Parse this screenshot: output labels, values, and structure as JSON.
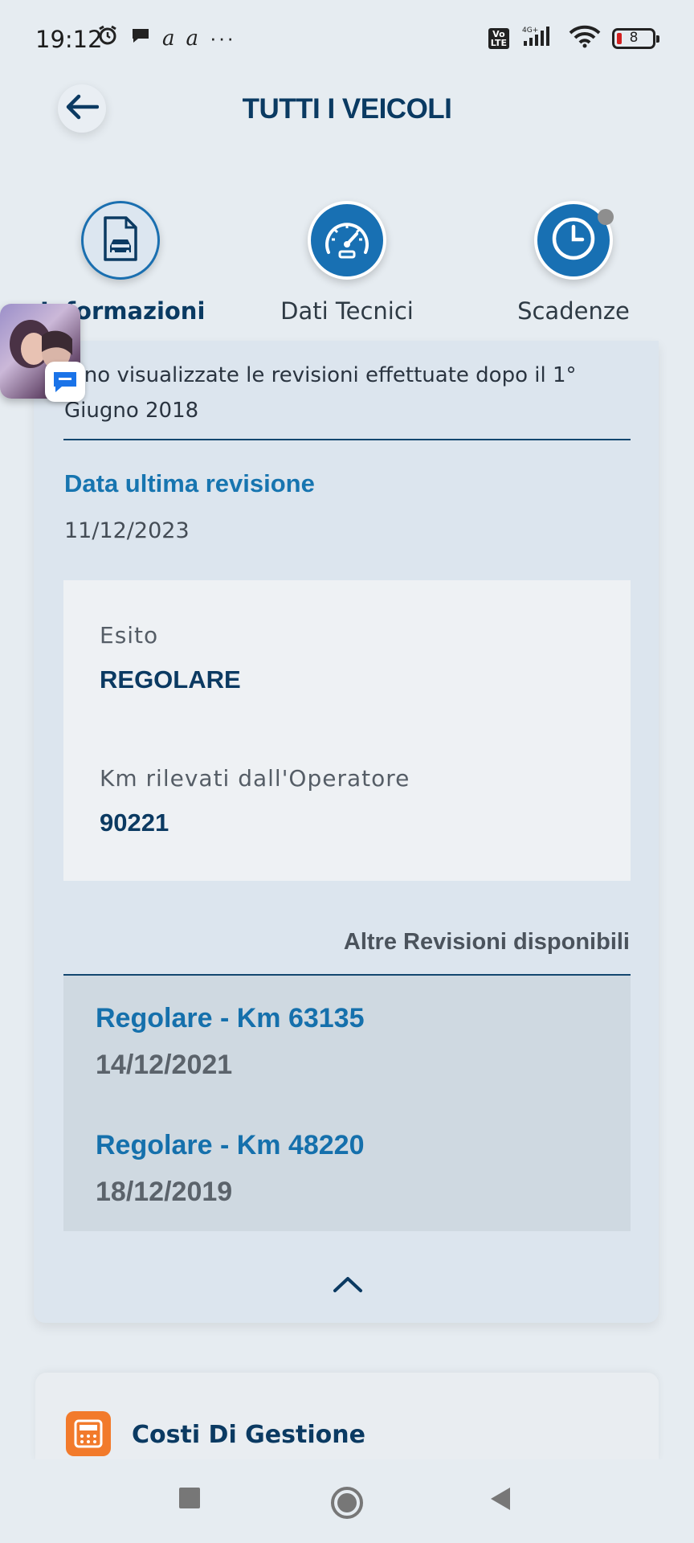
{
  "status_bar": {
    "time": "19:12",
    "battery": "8",
    "network": "4G+",
    "volte": "Vo LTE"
  },
  "header": {
    "title": "TUTTI I VEICOLI"
  },
  "tabs": [
    {
      "label": "Informazioni",
      "icon": "vehicle-document-icon",
      "active": true
    },
    {
      "label": "Dati Tecnici",
      "icon": "speedometer-icon",
      "active": false
    },
    {
      "label": "Scadenze",
      "icon": "clock-icon",
      "active": false
    }
  ],
  "revision": {
    "note": "...no visualizzate le revisioni effettuate dopo il 1° Giugno 2018",
    "last_title": "Data ultima revisione",
    "last_date": "11/12/2023",
    "esito_label": "Esito",
    "esito_value": "REGOLARE",
    "km_label": "Km rilevati dall'Operatore",
    "km_value": "90221",
    "others_label": "Altre Revisioni disponibili",
    "others": [
      {
        "title": "Regolare - Km 63135",
        "date": "14/12/2021"
      },
      {
        "title": "Regolare - Km 48220",
        "date": "18/12/2019"
      }
    ]
  },
  "costs": {
    "label": "Costi Di Gestione"
  },
  "colors": {
    "primary": "#0b3a62",
    "accent": "#1570ac",
    "orange": "#f27a2b"
  }
}
